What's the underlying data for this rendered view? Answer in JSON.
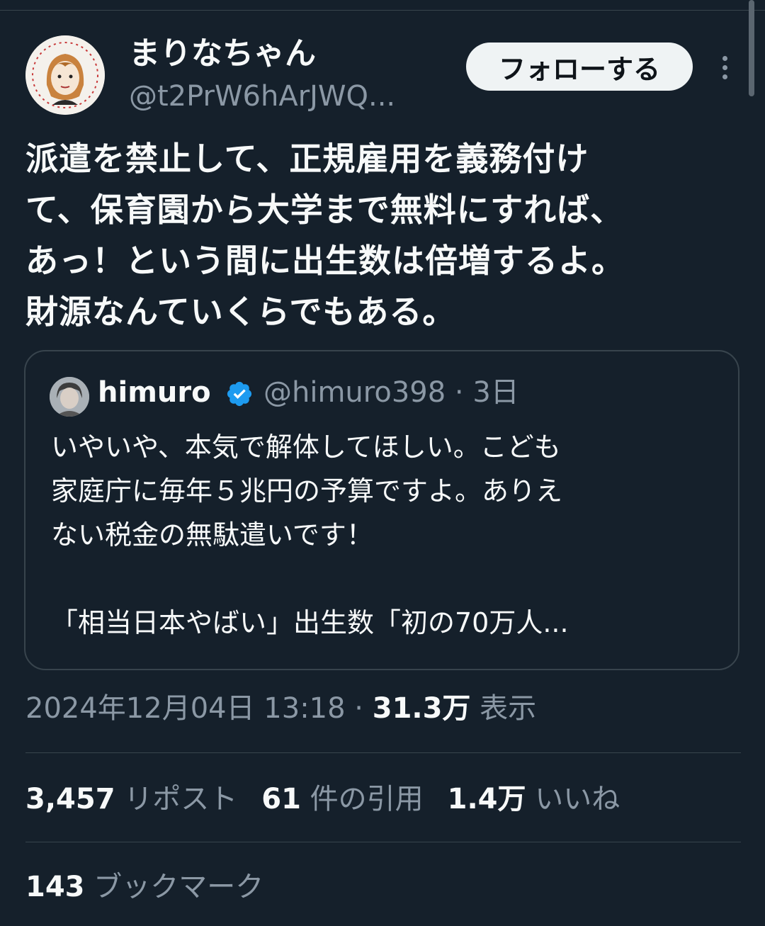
{
  "author": {
    "display_name": "まりなちゃん",
    "handle": "@t2PrW6hArJWQ...",
    "follow_label": "フォローする"
  },
  "tweet": {
    "text_lines": [
      "派遣を禁止して、正規雇用を義務付け",
      "て、保育園から大学まで無料にすれば、",
      "あっ！という間に出生数は倍増するよ。",
      "財源なんていくらでもある。"
    ]
  },
  "quote": {
    "name": "himuro",
    "handle_time": "@himuro398 · 3日",
    "text_lines": [
      "いやいや、本気で解体してほしい。こども",
      "家庭庁に毎年５兆円の予算ですよ。ありえ",
      "ない税金の無駄遣いです！",
      "",
      "「相当日本やばい」出生数「初の70万人..."
    ]
  },
  "meta": {
    "datetime": "2024年12月04日 13:18 · ",
    "views_count": "31.3万",
    "views_label": " 表示"
  },
  "stats": {
    "reposts_count": "3,457",
    "reposts_label": " リポスト",
    "quotes_count": "61",
    "quotes_label": " 件の引用",
    "likes_count": "1.4万",
    "likes_label": " いいね",
    "bookmarks_count": "143",
    "bookmarks_label": " ブックマーク"
  },
  "colors": {
    "background": "#15202b",
    "text": "#f7f9f9",
    "secondary": "#8b98a5",
    "border": "#38444d",
    "verified": "#1d9bf0"
  },
  "icons": {
    "more": "more-dots-icon",
    "verified": "verified-badge-icon"
  }
}
